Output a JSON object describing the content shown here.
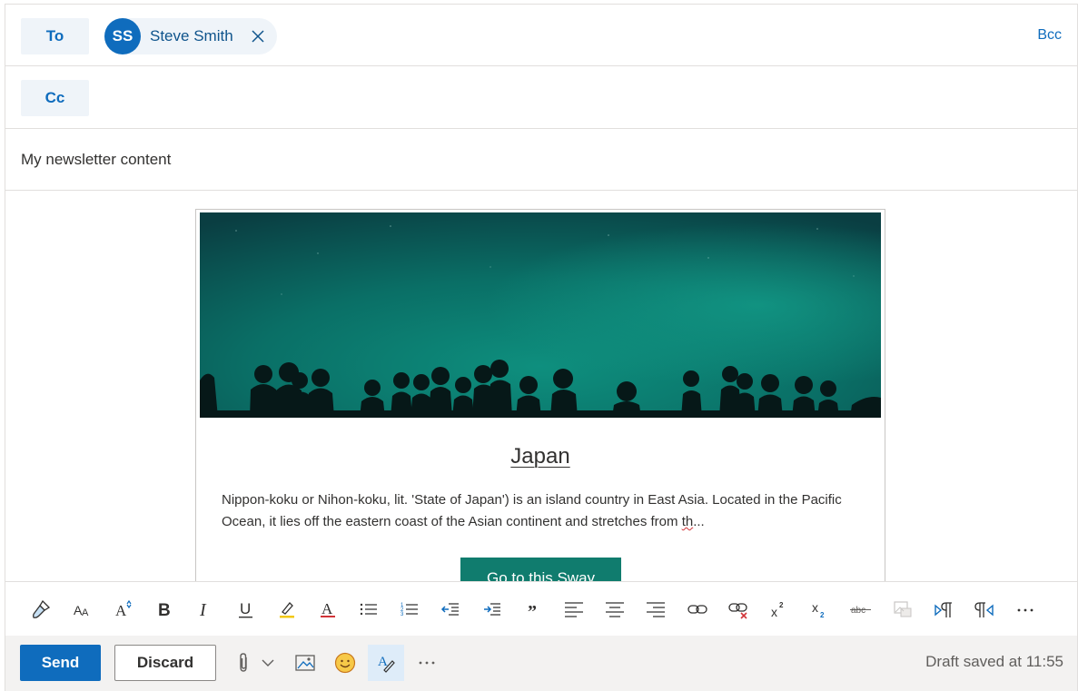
{
  "header": {
    "to_label": "To",
    "cc_label": "Cc",
    "bcc_label": "Bcc",
    "recipients": [
      {
        "initials": "SS",
        "name": "Steve Smith"
      }
    ]
  },
  "subject": {
    "value": "My newsletter content"
  },
  "body": {
    "card": {
      "title": "Japan",
      "description_main": "Nippon-koku or Nihon-koku, lit. 'State of Japan') is an island country in East Asia. Located in the Pacific Ocean, it lies off the eastern coast of the Asian continent and stretches from ",
      "description_flagged": "th",
      "description_ellipsis": "...",
      "button_label": "Go to this Sway"
    }
  },
  "formatting_toolbar": {
    "icons": [
      "format-painter-icon",
      "font-size-icon",
      "text-effects-icon",
      "bold-icon",
      "italic-icon",
      "underline-icon",
      "highlight-icon",
      "font-color-icon",
      "bullets-icon",
      "numbering-icon",
      "decrease-indent-icon",
      "increase-indent-icon",
      "quote-icon",
      "align-left-icon",
      "align-center-icon",
      "align-right-icon",
      "insert-link-icon",
      "remove-link-icon",
      "superscript-icon",
      "subscript-icon",
      "strikethrough-icon",
      "insert-image-disabled-icon",
      "ltr-icon",
      "rtl-icon",
      "more-icon"
    ],
    "strikethrough_text": "abc",
    "superscript_digit": "2",
    "subscript_digit": "2"
  },
  "actions": {
    "send_label": "Send",
    "discard_label": "Discard",
    "draft_status": "Draft saved at 11:55"
  },
  "colors": {
    "accent": "#0f6cbd",
    "sway_button": "#107c6e",
    "hero_teal": "#0f7b6c"
  }
}
